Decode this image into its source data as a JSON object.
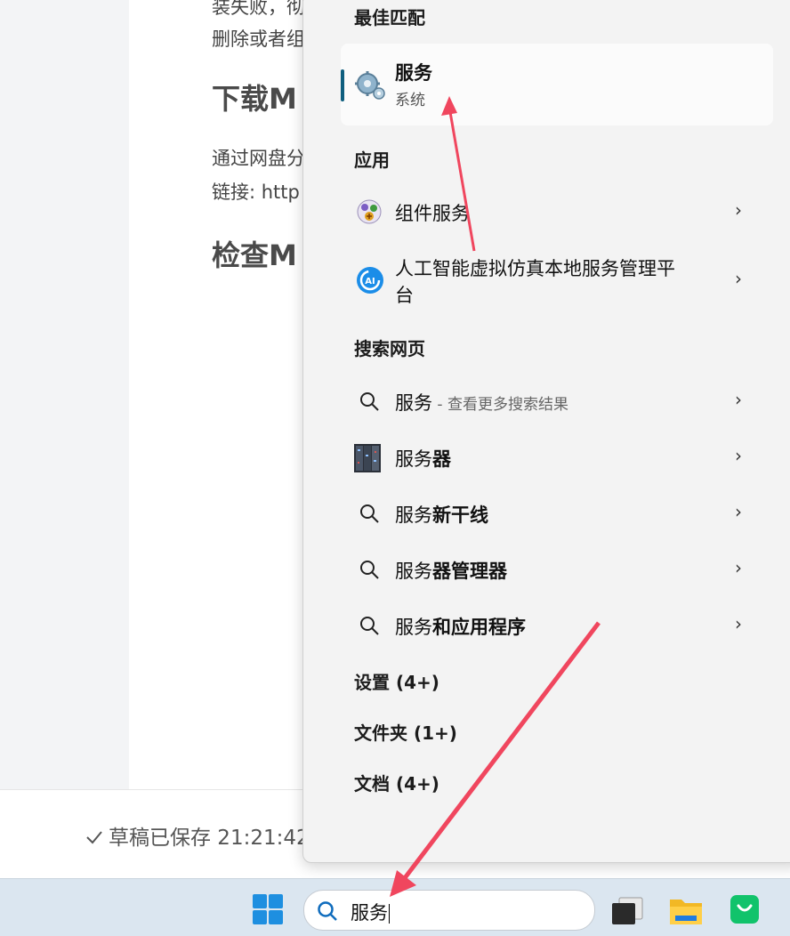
{
  "doc": {
    "line1": "装失败，彻",
    "line2": "删除或者组",
    "heading1": "下载M",
    "line3": "通过网盘分",
    "line4": "链接: http",
    "heading2": "检查M",
    "save_status": "草稿已保存 21:21:42"
  },
  "flyout": {
    "best_match_heading": "最佳匹配",
    "best_match": {
      "title": "服务",
      "subtitle": "系统"
    },
    "apps_heading": "应用",
    "apps": [
      {
        "label": "组件服务"
      },
      {
        "label_line1": "人工智能虚拟仿真本地服务管理平",
        "label_line2": "台"
      }
    ],
    "web_heading": "搜索网页",
    "web": [
      {
        "main": "服务",
        "hint": " - 查看更多搜索结果"
      },
      {
        "main": "服务",
        "bold": "器"
      },
      {
        "main": "服务",
        "bold": "新干线"
      },
      {
        "main": "服务",
        "bold": "器管理器"
      },
      {
        "main": "服务",
        "bold": "和应用程序"
      }
    ],
    "settings_heading": "设置 (4+)",
    "folders_heading": "文件夹 (1+)",
    "documents_heading": "文档 (4+)"
  },
  "taskbar": {
    "search_value": "服务"
  },
  "colors": {
    "accent": "#0f5f7f",
    "arrow": "#f0465e",
    "taskbar": "#dbe6f0",
    "windows_logo": "#1e8fe0"
  },
  "icons": [
    "services-gear-icon",
    "component-services-icon",
    "ai-platform-icon",
    "search-icon",
    "server-photo-icon",
    "chevron-right-icon",
    "windows-start-icon",
    "task-view-icon",
    "file-explorer-icon",
    "store-bag-icon"
  ]
}
